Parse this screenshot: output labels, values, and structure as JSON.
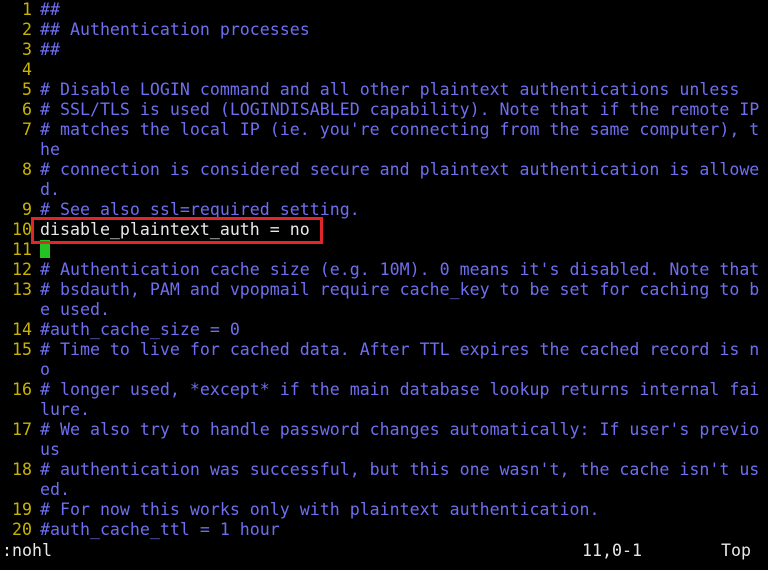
{
  "editor": {
    "rows": [
      {
        "num": "1",
        "text": "##",
        "kind": "comment"
      },
      {
        "num": "2",
        "text": "## Authentication processes",
        "kind": "comment"
      },
      {
        "num": "3",
        "text": "##",
        "kind": "comment"
      },
      {
        "num": "4",
        "text": "",
        "kind": "comment"
      },
      {
        "num": "5",
        "text": "# Disable LOGIN command and all other plaintext authentications unless",
        "kind": "comment"
      },
      {
        "num": "6",
        "text": "# SSL/TLS is used (LOGINDISABLED capability). Note that if the remote IP",
        "kind": "comment"
      },
      {
        "num": "7",
        "text": "# matches the local IP (ie. you're connecting from the same computer), t",
        "kind": "comment"
      },
      {
        "num": "",
        "text": "he",
        "kind": "comment"
      },
      {
        "num": "8",
        "text": "# connection is considered secure and plaintext authentication is allowe",
        "kind": "comment"
      },
      {
        "num": "",
        "text": "d.",
        "kind": "comment"
      },
      {
        "num": "9",
        "text": "# See also ssl=required setting.",
        "kind": "comment"
      },
      {
        "num": "10",
        "text": "disable_plaintext_auth = no",
        "kind": "plain"
      },
      {
        "num": "11",
        "text": "",
        "kind": "cursor"
      },
      {
        "num": "12",
        "text": "# Authentication cache size (e.g. 10M). 0 means it's disabled. Note that",
        "kind": "comment"
      },
      {
        "num": "13",
        "text": "# bsdauth, PAM and vpopmail require cache_key to be set for caching to b",
        "kind": "comment"
      },
      {
        "num": "",
        "text": "e used.",
        "kind": "comment"
      },
      {
        "num": "14",
        "text": "#auth_cache_size = 0",
        "kind": "comment"
      },
      {
        "num": "15",
        "text": "# Time to live for cached data. After TTL expires the cached record is n",
        "kind": "comment"
      },
      {
        "num": "",
        "text": "o",
        "kind": "comment"
      },
      {
        "num": "16",
        "text": "# longer used, *except* if the main database lookup returns internal fai",
        "kind": "comment"
      },
      {
        "num": "",
        "text": "lure.",
        "kind": "comment"
      },
      {
        "num": "17",
        "text": "# We also try to handle password changes automatically: If user's previo",
        "kind": "comment"
      },
      {
        "num": "",
        "text": "us",
        "kind": "comment"
      },
      {
        "num": "18",
        "text": "# authentication was successful, but this one wasn't, the cache isn't us",
        "kind": "comment"
      },
      {
        "num": "",
        "text": "ed.",
        "kind": "comment"
      },
      {
        "num": "19",
        "text": "# For now this works only with plaintext authentication.",
        "kind": "comment"
      },
      {
        "num": "20",
        "text": "#auth_cache_ttl = 1 hour",
        "kind": "comment"
      }
    ]
  },
  "status": {
    "command": ":nohl",
    "position": "11,0-1",
    "scroll": "Top"
  },
  "colors": {
    "background": "#000000",
    "line_number": "#c8b400",
    "comment": "#6e6ef0",
    "text": "#e8e8e8",
    "cursor": "#22c322",
    "highlight_box": "#e0262a"
  }
}
